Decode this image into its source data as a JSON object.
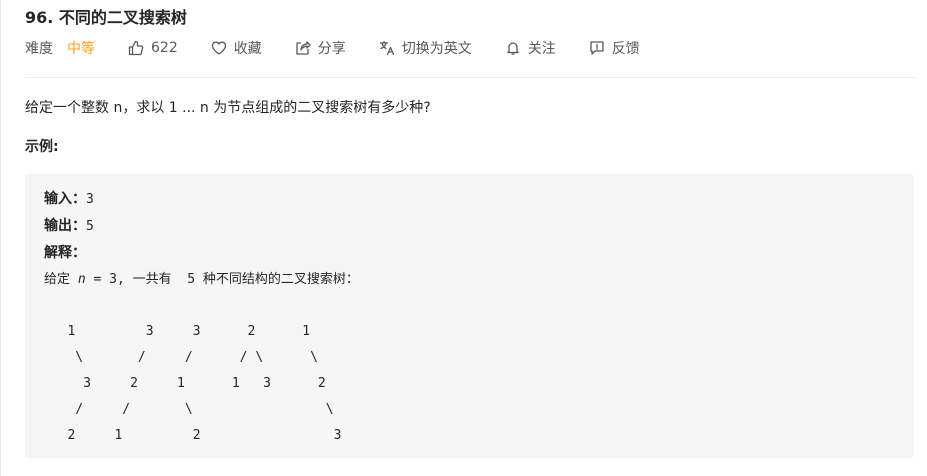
{
  "problem": {
    "title": "96. 不同的二叉搜索树",
    "difficulty_label": "难度",
    "difficulty_value": "中等",
    "difficulty_color": "#ffa116",
    "likes": "622",
    "favorite_label": "收藏",
    "share_label": "分享",
    "translate_label": "切换为英文",
    "follow_label": "关注",
    "feedback_label": "反馈",
    "description": "给定一个整数 n，求以 1 ... n 为节点组成的二叉搜索树有多少种?",
    "example_heading": "示例:"
  },
  "example": {
    "input_label": "输入：",
    "input_value": "3",
    "output_label": "输出：",
    "output_value": "5",
    "explain_label": "解释：",
    "explain_prefix": "给定 ",
    "explain_var": "n",
    "explain_suffix": " = 3, 一共有  5 种不同结构的二叉搜索树：",
    "tree_art": "\n   1         3     3      2      1\n    \\       /     /      / \\      \\\n     3     2     1      1   3      2\n    /     /       \\                 \\\n   2     1         2                 3"
  },
  "icons": [
    "thumbs-up-icon",
    "heart-icon",
    "share-icon",
    "translate-icon",
    "bell-icon",
    "feedback-icon"
  ]
}
